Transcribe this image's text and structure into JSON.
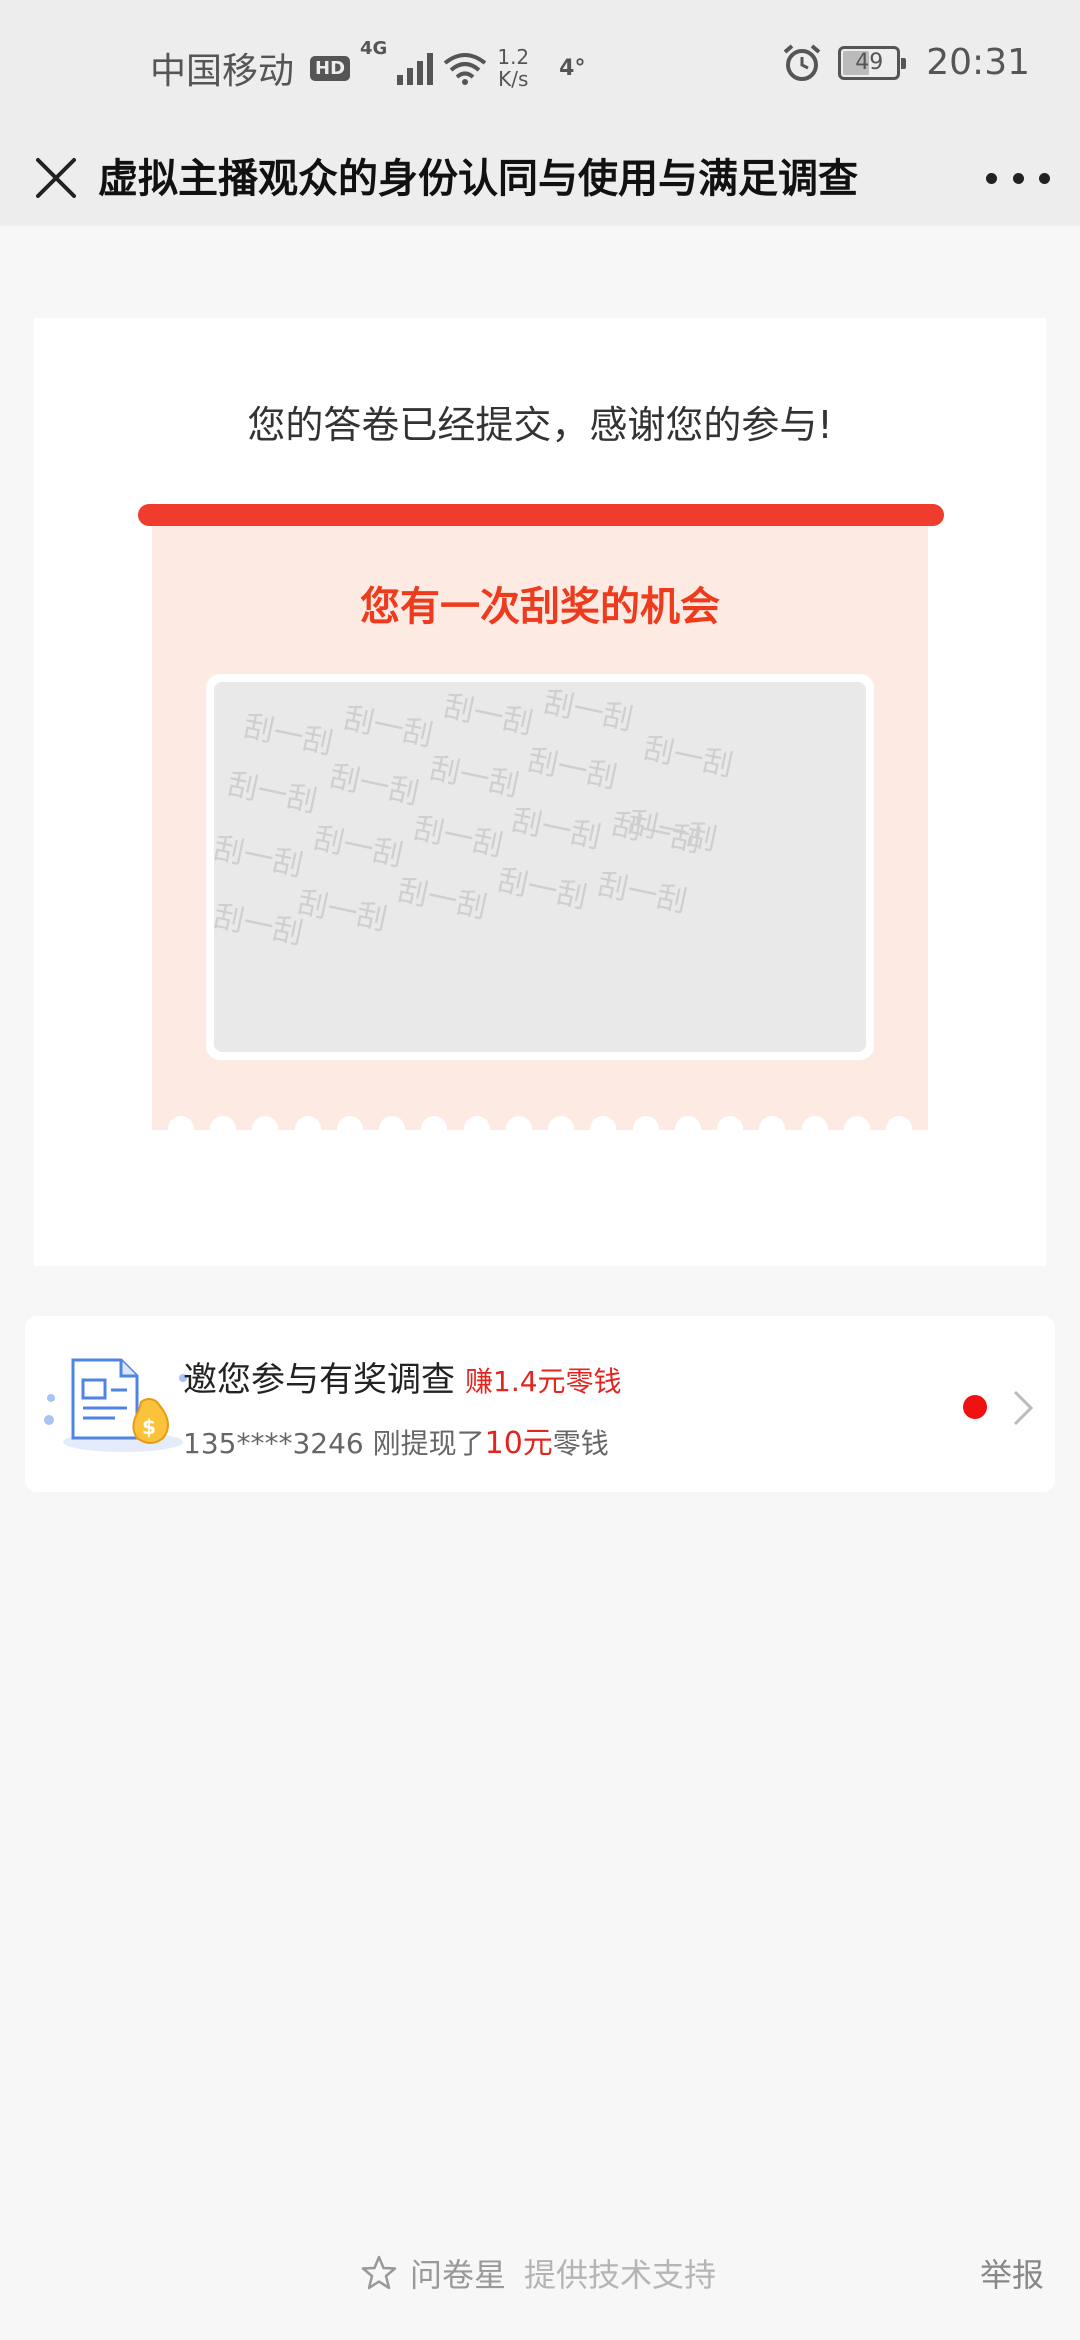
{
  "status_bar": {
    "carrier": "中国移动",
    "hd": "HD",
    "network": "4G",
    "speed_value": "1.2",
    "speed_unit": "K/s",
    "temperature": "4°",
    "battery": "49",
    "time": "20:31"
  },
  "nav": {
    "title": "虚拟主播观众的身份认同与使用与满足调查"
  },
  "result": {
    "submitted_text": "您的答卷已经提交，感谢您的参与!",
    "lottery_title": "您有一次刮奖的机会",
    "scratch_watermark": "刮一刮"
  },
  "promo": {
    "title": "邀您参与有奖调查",
    "earn": "赚1.4元零钱",
    "sub_user": "135****3246 刚提现了",
    "sub_amount": "10元",
    "sub_suffix": "零钱"
  },
  "footer": {
    "brand": "问卷星",
    "support": "提供技术支持",
    "report": "举报"
  },
  "colors": {
    "accent_red": "#ee3b1e",
    "ticket_bg": "#fdebe3",
    "dot_red": "#f01212"
  }
}
